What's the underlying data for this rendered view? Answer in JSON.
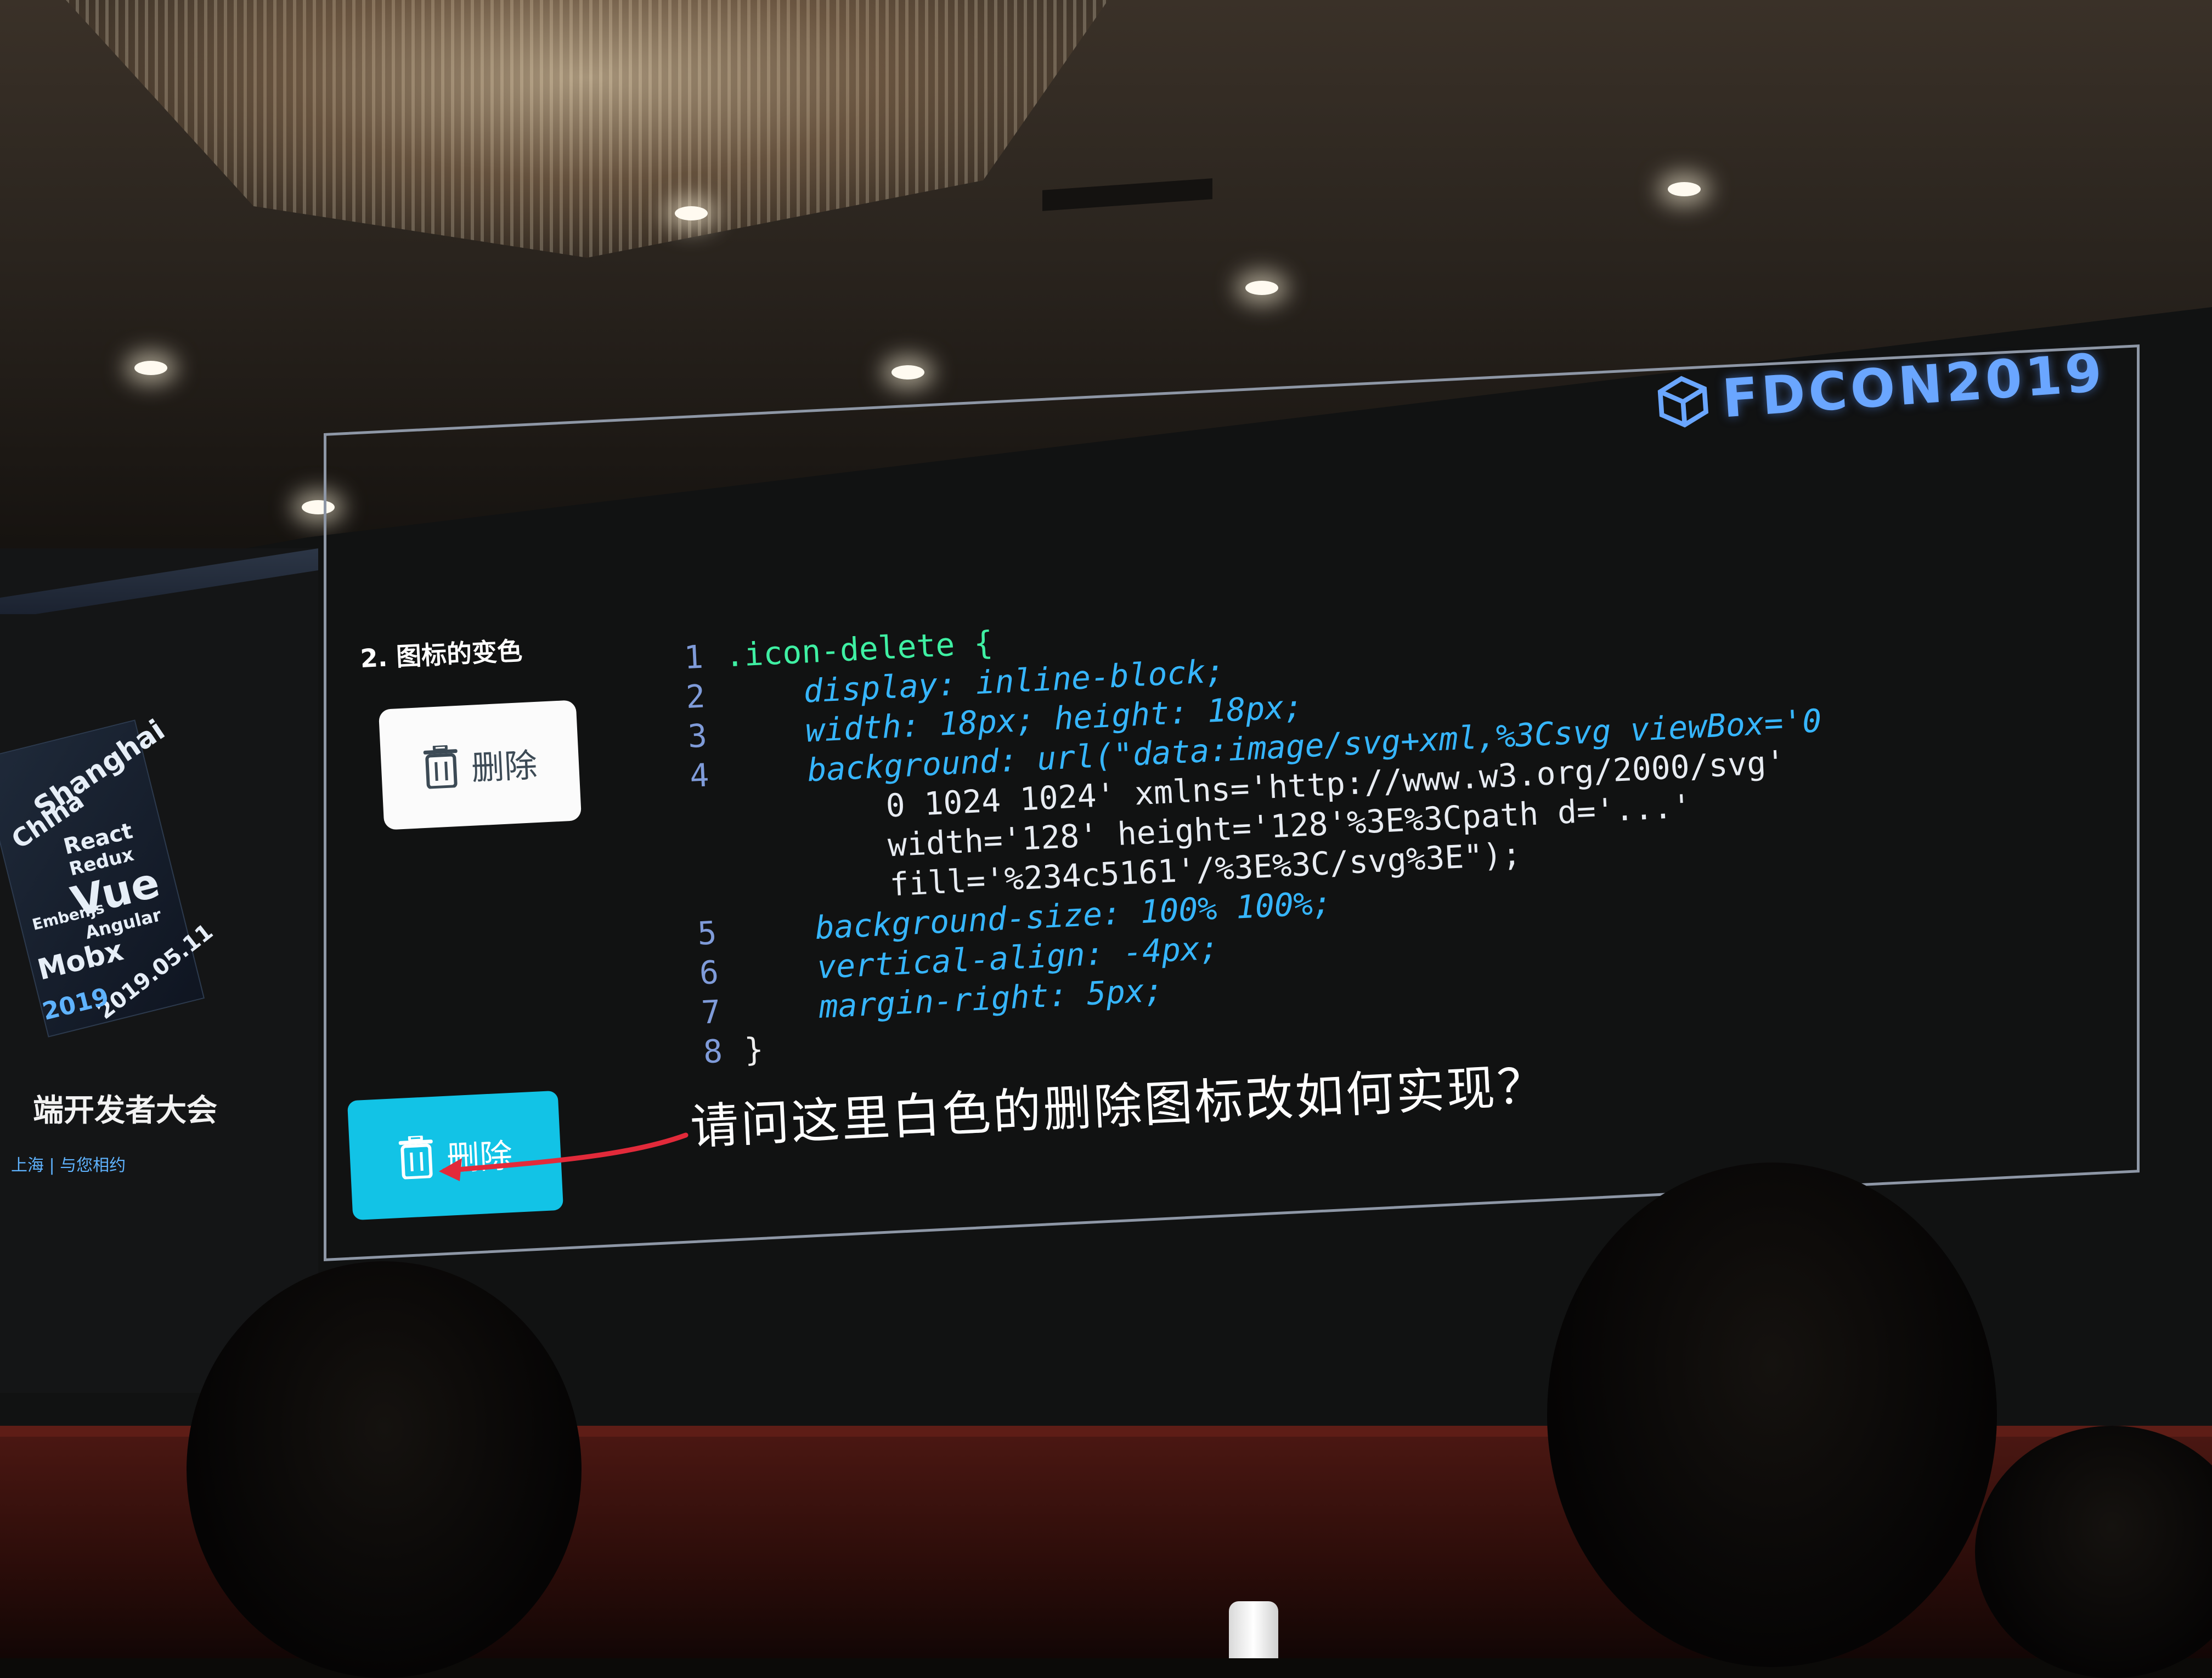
{
  "brand": {
    "logo_text": "FDCON2019",
    "logo_color": "#6aa6ff"
  },
  "side_screen": {
    "cube_words": [
      "Shanghai",
      "China",
      "React",
      "Redux",
      "Vue",
      "Angular",
      "Mobx",
      "Ember.js",
      "2019.05.11",
      "2019"
    ],
    "title": "端开发者大会",
    "subtitle": "上海 | 与您相约"
  },
  "slide": {
    "heading": "2. 图标的变色",
    "white_button": {
      "label": "删除",
      "icon": "trash-icon",
      "bg": "#fbfbfb"
    },
    "cyan_button": {
      "label": "删除",
      "icon": "trash-icon",
      "bg": "#12c3e6"
    },
    "question": "请问这里白色的删除图标改如何实现？",
    "code": {
      "line_numbers": [
        "1",
        "2",
        "3",
        "4",
        "",
        "",
        "5",
        "6",
        "7",
        "8"
      ],
      "lines": [
        ".icon-delete {",
        "    display: inline-block;",
        "    width: 18px; height: 18px;",
        "    background: url(\"data:image/svg+xml,%3Csvg viewBox='0",
        "        0 1024 1024' xmlns='http://www.w3.org/2000/svg'",
        "        width='128' height='128'%3E%3Cpath d='...'",
        "        fill='%234c5161'/%3E%3C/svg%3E\");",
        "    background-size: 100% 100%;",
        "    vertical-align: -4px;",
        "    margin-right: 5px;",
        "}"
      ]
    }
  }
}
